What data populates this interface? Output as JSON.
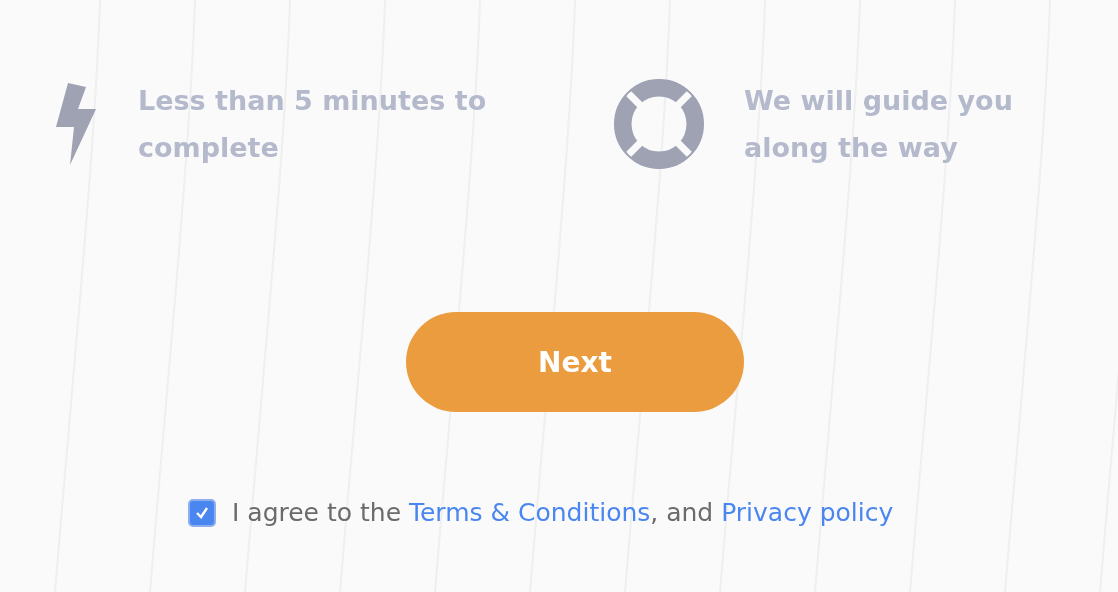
{
  "features": [
    {
      "kind": "bolt",
      "text": "Less than 5 minutes to complete"
    },
    {
      "kind": "lifebuoy",
      "text": "We will guide you along the way"
    }
  ],
  "next_button": {
    "label": "Next"
  },
  "agreement": {
    "checked": true,
    "before": "I agree to the",
    "links": [
      "Terms & Conditions",
      "Privacy policy"
    ],
    "between": ", and"
  }
}
